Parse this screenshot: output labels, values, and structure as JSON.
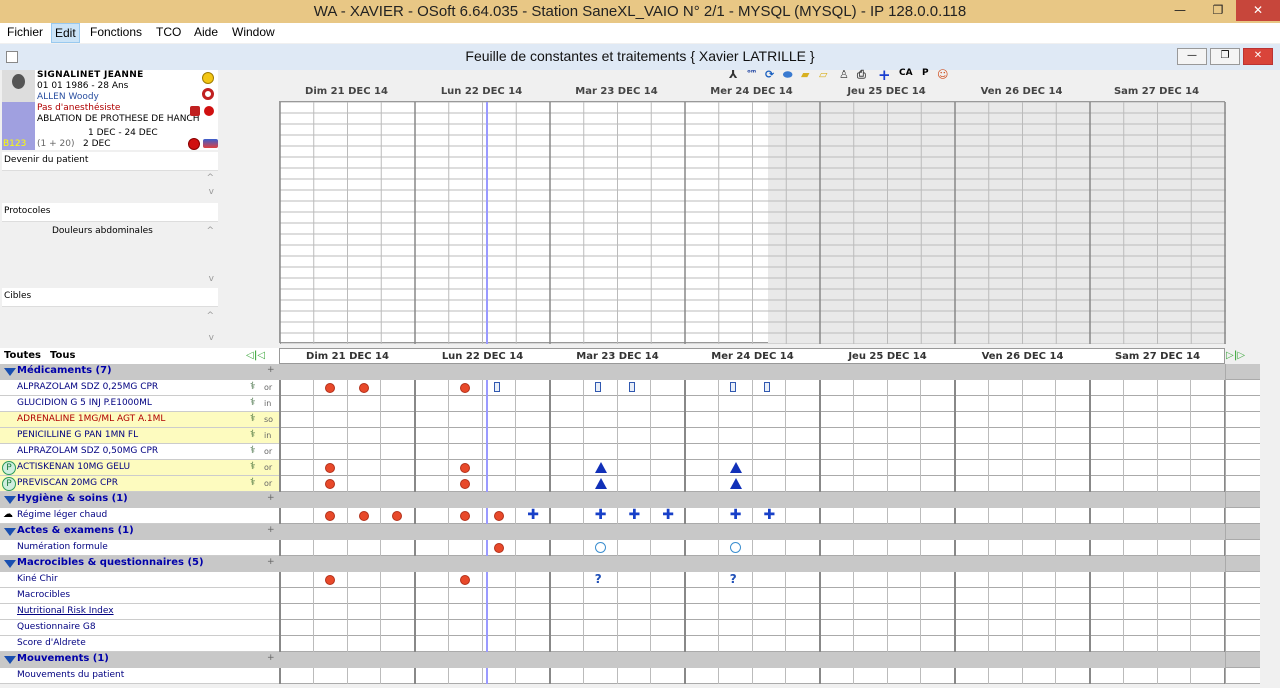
{
  "window": {
    "title": "WA - XAVIER - OSoft 6.64.035 - Station SaneXL_VAIO N° 2/1 - MYSQL (MYSQL) - IP 128.0.0.118",
    "min": "—",
    "restore": "❐",
    "close": "✕"
  },
  "menu": [
    "Fichier",
    "Edit",
    "Fonctions",
    "TCO",
    "Aide",
    "Window"
  ],
  "doc": {
    "title": "Feuille de constantes et traitements   {  Xavier LATRILLE  }",
    "min": "—",
    "restore": "❐",
    "close": "✕"
  },
  "patient": {
    "name": "SIGNALINET JEANNE",
    "birth": "01 01 1986 - 28 Ans",
    "doctor": "ALLEN Woody",
    "anesth": "Pas d'anesthésiste",
    "procedure": "ABLATION DE PROTHESE DE HANCHE",
    "dates": "1 DEC - 24 DEC",
    "stay": "(1 + 20)",
    "stay_date": "2 DEC",
    "room": "B123"
  },
  "panels": {
    "devenir": "Devenir du patient",
    "protocoles": "Protocoles",
    "protocole_item": "Douleurs abdominales",
    "cibles": "Cibles"
  },
  "toolbar": {
    "ca": "CA",
    "p": "P"
  },
  "days": [
    "Dim 21 DEC 14",
    "Lun 22 DEC 14",
    "Mar 23 DEC 14",
    "Mer 24 DEC 14",
    "Jeu 25 DEC 14",
    "Ven 26 DEC 14",
    "Sam 27 DEC 14"
  ],
  "tabs": {
    "toutes": "Toutes",
    "tous": "Tous"
  },
  "rows": [
    {
      "type": "sec",
      "label": "Médicaments (7)"
    },
    {
      "type": "item",
      "label": "ALPRAZOLAM SDZ 0,25MG CPR",
      "route": "or",
      "steth": true,
      "hl": false,
      "color": "#000080"
    },
    {
      "type": "item",
      "label": "GLUCIDION G 5 INJ P.E1000ML",
      "route": "in",
      "steth": true,
      "hl": false,
      "color": "#000080"
    },
    {
      "type": "item",
      "label": "ADRENALINE 1MG/ML AGT A.1ML",
      "route": "so",
      "steth": true,
      "hl": true,
      "color": "#b00000"
    },
    {
      "type": "item",
      "label": "PENICILLINE G PAN 1MN FL",
      "route": "in",
      "steth": true,
      "hl": true,
      "color": "#000080"
    },
    {
      "type": "item",
      "label": "ALPRAZOLAM SDZ 0,50MG CPR",
      "route": "or",
      "steth": true,
      "hl": false,
      "color": "#000080"
    },
    {
      "type": "item",
      "label": "ACTISKENAN 10MG GELU",
      "route": "or",
      "steth": true,
      "hl": true,
      "color": "#000080",
      "pcirc": "P"
    },
    {
      "type": "item",
      "label": "PREVISCAN 20MG CPR",
      "route": "or",
      "steth": true,
      "hl": true,
      "color": "#000080",
      "pcirc": "P"
    },
    {
      "type": "sec",
      "label": "Hygiène & soins (1)"
    },
    {
      "type": "item",
      "label": "Régime léger chaud",
      "route": "",
      "steth": false,
      "hl": false,
      "color": "#000080"
    },
    {
      "type": "sec",
      "label": "Actes & examens (1)"
    },
    {
      "type": "item",
      "label": "Numération formule",
      "route": "",
      "steth": false,
      "hl": false,
      "color": "#000080"
    },
    {
      "type": "sec",
      "label": "Macrocibles & questionnaires (5)"
    },
    {
      "type": "item",
      "label": "Kiné Chir",
      "route": "",
      "steth": false,
      "hl": false,
      "color": "#000080"
    },
    {
      "type": "item",
      "label": "Macrocibles",
      "route": "",
      "steth": false,
      "hl": false,
      "color": "#000080"
    },
    {
      "type": "item",
      "label": "Nutritional Risk Index",
      "route": "",
      "steth": false,
      "hl": false,
      "color": "#000080"
    },
    {
      "type": "item",
      "label": "Questionnaire G8",
      "route": "",
      "steth": false,
      "hl": false,
      "color": "#000080"
    },
    {
      "type": "item",
      "label": "Score d'Aldrete",
      "route": "",
      "steth": false,
      "hl": false,
      "color": "#000080"
    },
    {
      "type": "sec",
      "label": "Mouvements (1)"
    },
    {
      "type": "item",
      "label": "Mouvements du patient",
      "route": "",
      "steth": false,
      "hl": false,
      "color": "#000080"
    }
  ]
}
